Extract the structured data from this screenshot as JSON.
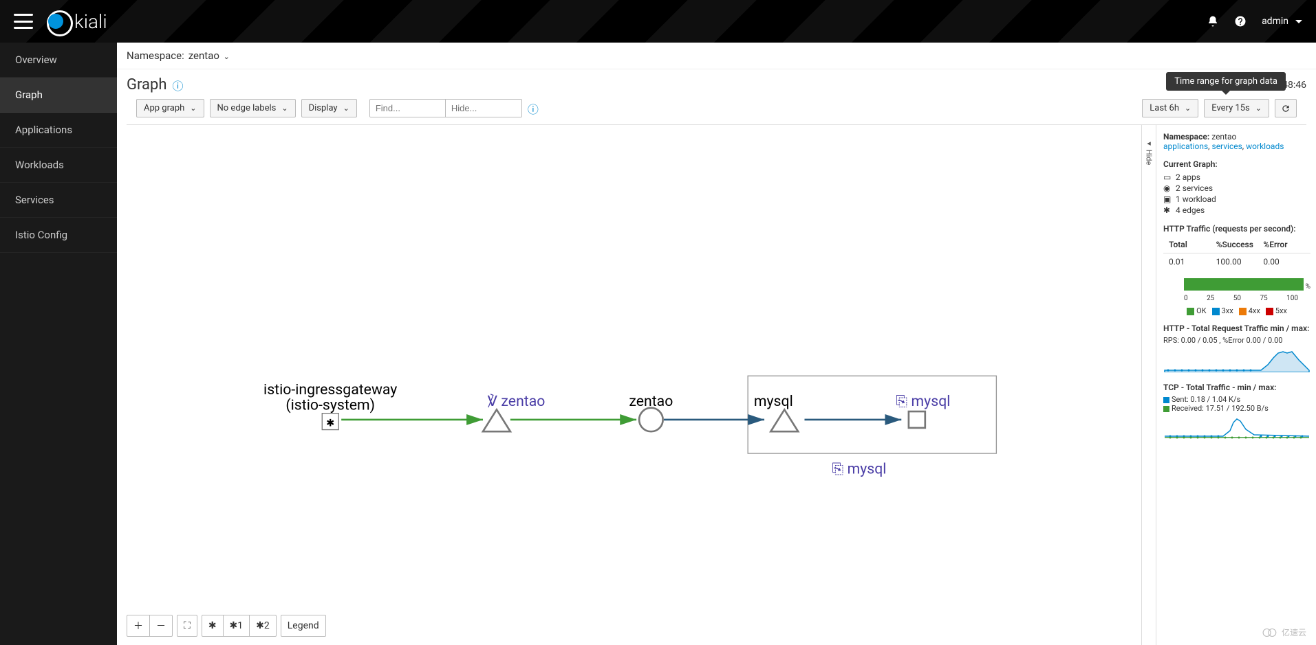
{
  "topbar": {
    "brand": "kiali",
    "user": "admin"
  },
  "sidebar": {
    "items": [
      {
        "label": "Overview"
      },
      {
        "label": "Graph",
        "active": true
      },
      {
        "label": "Applications"
      },
      {
        "label": "Workloads"
      },
      {
        "label": "Services"
      },
      {
        "label": "Istio Config"
      }
    ]
  },
  "breadcrumb": {
    "namespace_label": "Namespace:",
    "namespace_value": "zentao"
  },
  "title": "Graph",
  "timestamp": "8:48:46",
  "tooltip": "Time range for graph data",
  "toolbar": {
    "graph_type": "App graph",
    "edge_labels": "No edge labels",
    "display": "Display",
    "find_placeholder": "Find...",
    "hide_placeholder": "Hide...",
    "duration": "Last 6h",
    "refresh": "Every 15s"
  },
  "graph": {
    "nodes": {
      "gateway": {
        "line1": "istio-ingressgateway",
        "line2": "(istio-system)"
      },
      "zentao_svc": "zentao",
      "zentao_app": "zentao",
      "mysql_app": "mysql",
      "mysql_svc": "mysql",
      "mysql_box": "mysql"
    }
  },
  "controls": {
    "layout1": "1",
    "layout2": "2",
    "legend": "Legend"
  },
  "panel": {
    "hide_label": "Hide",
    "ns_label": "Namespace:",
    "ns_value": "zentao",
    "links": {
      "apps": "applications",
      "svcs": "services",
      "wkls": "workloads"
    },
    "current_graph_label": "Current Graph:",
    "stats": [
      {
        "label": "2 apps",
        "icon": "apps"
      },
      {
        "label": "2 services",
        "icon": "svc"
      },
      {
        "label": "1 workload",
        "icon": "wkl"
      },
      {
        "label": "4 edges",
        "icon": "edge"
      }
    ],
    "http_hdr": "HTTP Traffic (requests per second):",
    "http_cols": {
      "total": "Total",
      "success": "%Success",
      "error": "%Error"
    },
    "http_row": {
      "total": "0.01",
      "success": "100.00",
      "error": "0.00"
    },
    "legend": {
      "ok": "OK",
      "3xx": "3xx",
      "4xx": "4xx",
      "5xx": "5xx"
    },
    "axis": [
      "0",
      "25",
      "50",
      "75",
      "100"
    ],
    "http_req_hdr": "HTTP - Total Request Traffic min / max:",
    "http_req_sub": "RPS: 0.00 / 0.05 , %Error 0.00 / 0.00",
    "tcp_hdr": "TCP - Total Traffic - min / max:",
    "tcp_sent": "Sent: 0.18 / 1.04 K/s",
    "tcp_recv": "Received: 17.51 / 192.50 B/s"
  },
  "watermark": "亿速云",
  "chart_data": {
    "http_status_bar": {
      "type": "bar",
      "categories": [
        "OK",
        "3xx",
        "4xx",
        "5xx"
      ],
      "values": [
        100,
        0,
        0,
        0
      ],
      "xlim": [
        0,
        100
      ],
      "colors": {
        "OK": "#3f9c35",
        "3xx": "#0088ce",
        "4xx": "#ec7a08",
        "5xx": "#cc0000"
      }
    },
    "http_request_sparkline": {
      "type": "area",
      "values": [
        0.0,
        0.0,
        0.0,
        0.0,
        0.0,
        0.0,
        0.0,
        0.0,
        0.0,
        0.0,
        0.0,
        0.0,
        0.0,
        0.0,
        0.0,
        0.0,
        0.0,
        0.0,
        0.0,
        0.02,
        0.03,
        0.05,
        0.04,
        0.05,
        0.03,
        0.01
      ],
      "ylim": [
        0,
        0.05
      ]
    },
    "tcp_sparkline": {
      "type": "line",
      "series": [
        {
          "name": "Sent",
          "color": "#0088ce",
          "values": [
            0.18,
            0.18,
            0.18,
            0.18,
            0.18,
            0.18,
            0.18,
            0.18,
            0.18,
            0.18,
            0.18,
            0.18,
            0.18,
            0.35,
            0.6,
            1.04,
            0.8,
            0.4,
            0.25,
            0.2,
            0.18,
            0.18,
            0.18,
            0.18,
            0.18,
            0.18
          ]
        },
        {
          "name": "Received",
          "color": "#3f9c35",
          "values": [
            20,
            20,
            20,
            20,
            20,
            20,
            20,
            20,
            20,
            20,
            20,
            20,
            20,
            20,
            20,
            20,
            20,
            20,
            20,
            20,
            20,
            20,
            20,
            20,
            20,
            20
          ]
        }
      ],
      "ylim_sent": [
        0,
        1.04
      ],
      "ylim_recv": [
        0,
        192.5
      ]
    }
  }
}
